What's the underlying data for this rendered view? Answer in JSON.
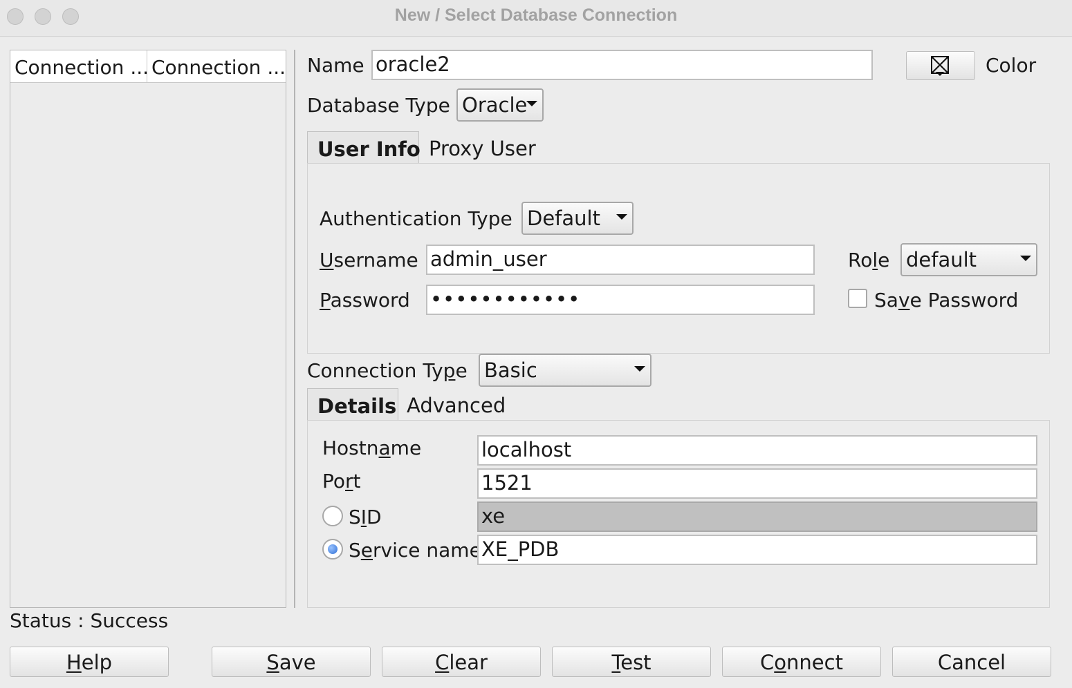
{
  "window": {
    "title": "New / Select Database Connection"
  },
  "list": {
    "columns": [
      "Connection ...",
      "Connection ..."
    ]
  },
  "name": {
    "label": "Name",
    "value": "oracle2"
  },
  "color": {
    "label": "Color",
    "icon": "color-picker-icon"
  },
  "database_type": {
    "label": "Database Type",
    "value": "Oracle"
  },
  "user_tabs": [
    {
      "label": "User Info",
      "active": true
    },
    {
      "label": "Proxy User",
      "active": false
    }
  ],
  "auth": {
    "label": "Authentication Type",
    "value": "Default"
  },
  "username": {
    "label_pre": "",
    "label_u": "U",
    "label_post": "sername",
    "value": "admin_user"
  },
  "password": {
    "label_pre": "",
    "label_u": "P",
    "label_post": "assword",
    "value": "••••••••••••"
  },
  "role": {
    "label_pre": "Ro",
    "label_u": "l",
    "label_post": "e",
    "value": "default"
  },
  "save_password": {
    "label_pre": "Sa",
    "label_u": "v",
    "label_post": "e Password",
    "checked": false
  },
  "connection_type": {
    "label_pre": "Connection Ty",
    "label_u": "p",
    "label_post": "e",
    "value": "Basic"
  },
  "detail_tabs": [
    {
      "label": "Details",
      "active": true
    },
    {
      "label": "Advanced",
      "active": false
    }
  ],
  "hostname": {
    "label_pre": "Hostn",
    "label_u": "a",
    "label_post": "me",
    "value": "localhost"
  },
  "port": {
    "label_pre": "Po",
    "label_u": "r",
    "label_post": "t",
    "value": "1521"
  },
  "sid": {
    "label_pre": "S",
    "label_u": "I",
    "label_post": "D",
    "value": "xe",
    "selected": false
  },
  "service_name": {
    "label_pre": "S",
    "label_u": "e",
    "label_post": "rvice name",
    "value": "XE_PDB",
    "selected": true
  },
  "status": {
    "text": "Status : Success"
  },
  "buttons": {
    "help": {
      "pre": "",
      "u": "H",
      "post": "elp"
    },
    "save": {
      "pre": "",
      "u": "S",
      "post": "ave"
    },
    "clear": {
      "pre": "",
      "u": "C",
      "post": "lear"
    },
    "test": {
      "pre": "",
      "u": "T",
      "post": "est"
    },
    "connect": {
      "pre": "C",
      "u": "o",
      "post": "nnect"
    },
    "cancel": {
      "pre": "Cancel",
      "u": "",
      "post": ""
    }
  }
}
